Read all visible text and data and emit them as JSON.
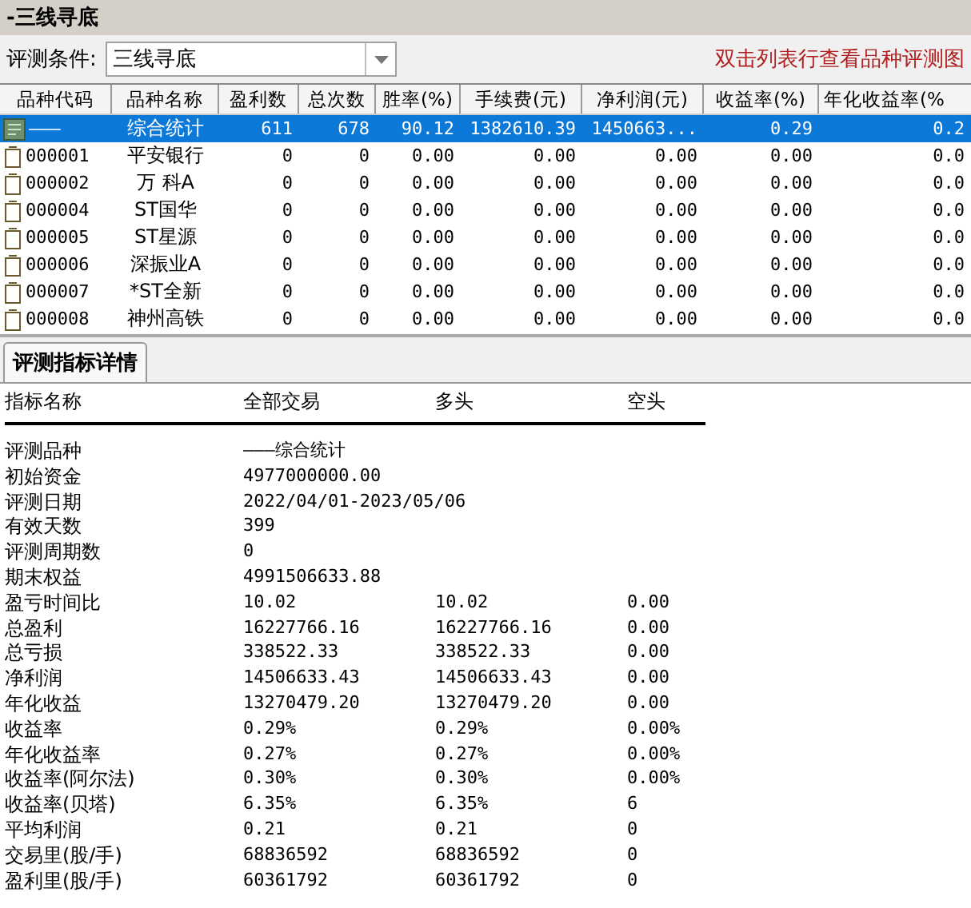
{
  "window": {
    "title": "-三线寻底"
  },
  "toolbar": {
    "label": "评测条件:",
    "condition": "三线寻底",
    "hint": "双击列表行查看品种评测图"
  },
  "table": {
    "columns": [
      "品种代码",
      "品种名称",
      "盈利数",
      "总次数",
      "胜率(%)",
      "手续费(元)",
      "净利润(元)",
      "收益率(%)",
      "年化收益率(%"
    ],
    "rows": [
      {
        "kind": "summary",
        "selected": true,
        "cells": [
          "———",
          "综合统计",
          "611",
          "678",
          "90.12",
          "1382610.39",
          "1450663...",
          "0.29",
          "0.2"
        ]
      },
      {
        "kind": "stock",
        "selected": false,
        "cells": [
          "000001",
          "平安银行",
          "0",
          "0",
          "0.00",
          "0.00",
          "0.00",
          "0.00",
          "0.0"
        ]
      },
      {
        "kind": "stock",
        "selected": false,
        "cells": [
          "000002",
          "万 科A",
          "0",
          "0",
          "0.00",
          "0.00",
          "0.00",
          "0.00",
          "0.0"
        ]
      },
      {
        "kind": "stock",
        "selected": false,
        "cells": [
          "000004",
          "ST国华",
          "0",
          "0",
          "0.00",
          "0.00",
          "0.00",
          "0.00",
          "0.0"
        ]
      },
      {
        "kind": "stock",
        "selected": false,
        "cells": [
          "000005",
          "ST星源",
          "0",
          "0",
          "0.00",
          "0.00",
          "0.00",
          "0.00",
          "0.0"
        ]
      },
      {
        "kind": "stock",
        "selected": false,
        "cells": [
          "000006",
          "深振业A",
          "0",
          "0",
          "0.00",
          "0.00",
          "0.00",
          "0.00",
          "0.0"
        ]
      },
      {
        "kind": "stock",
        "selected": false,
        "cells": [
          "000007",
          "*ST全新",
          "0",
          "0",
          "0.00",
          "0.00",
          "0.00",
          "0.00",
          "0.0"
        ]
      },
      {
        "kind": "stock",
        "selected": false,
        "cells": [
          "000008",
          "神州高铁",
          "0",
          "0",
          "0.00",
          "0.00",
          "0.00",
          "0.00",
          "0.0"
        ]
      }
    ]
  },
  "detail_tab": {
    "label": "评测指标详情",
    "selected": true
  },
  "details": {
    "columns": [
      "指标名称",
      "全部交易",
      "多头",
      "空头"
    ],
    "rows": [
      [
        "评测品种",
        "———综合统计"
      ],
      [
        "初始资金",
        "4977000000.00"
      ],
      [
        "评测日期",
        "2022/04/01-2023/05/06"
      ],
      [
        "有效天数",
        "399"
      ],
      [
        "评测周期数",
        "0"
      ],
      [
        "期末权益",
        "4991506633.88"
      ],
      [
        "盈亏时间比",
        "10.02",
        "10.02",
        "0.00"
      ],
      [
        "总盈利",
        "16227766.16",
        "16227766.16",
        "0.00"
      ],
      [
        "总亏损",
        "338522.33",
        "338522.33",
        "0.00"
      ],
      [
        "净利润",
        "14506633.43",
        "14506633.43",
        "0.00"
      ],
      [
        "年化收益",
        "13270479.20",
        "13270479.20",
        "0.00"
      ],
      [
        "收益率",
        "0.29%",
        "0.29%",
        "0.00%"
      ],
      [
        "年化收益率",
        "0.27%",
        "0.27%",
        "0.00%"
      ],
      [
        "收益率(阿尔法)",
        "0.30%",
        "0.30%",
        "0.00%"
      ],
      [
        "收益率(贝塔)",
        "6.35%",
        "6.35%",
        "6"
      ],
      [
        "平均利润",
        "0.21",
        "0.21",
        "0"
      ],
      [
        "交易里(股/手)",
        "68836592",
        "68836592",
        "0"
      ],
      [
        "盈利里(股/手)",
        "60361792",
        "60361792",
        "0"
      ]
    ]
  }
}
